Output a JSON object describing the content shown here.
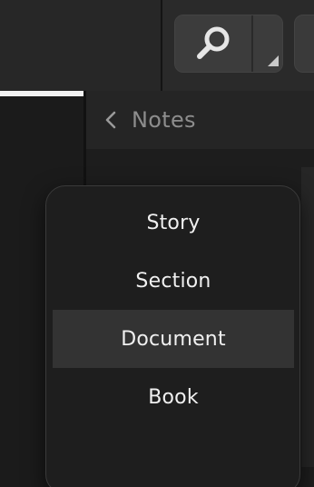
{
  "notes_pane": {
    "title": "Notes"
  },
  "menu": {
    "items": [
      {
        "label": "Story",
        "selected": false
      },
      {
        "label": "Section",
        "selected": false
      },
      {
        "label": "Document",
        "selected": true
      },
      {
        "label": "Book",
        "selected": false
      }
    ]
  },
  "icons": {
    "search": "magnifier-icon",
    "dropdown": "dropdown-corner-icon",
    "back": "chevron-left-icon"
  },
  "colors": {
    "background": "#161616",
    "menu_background": "#1e1e1e",
    "menu_selected": "#333333",
    "menu_text": "#f0f0f0",
    "notes_title": "#8d8d8d",
    "toolbar_button": "#3c3c3c"
  }
}
